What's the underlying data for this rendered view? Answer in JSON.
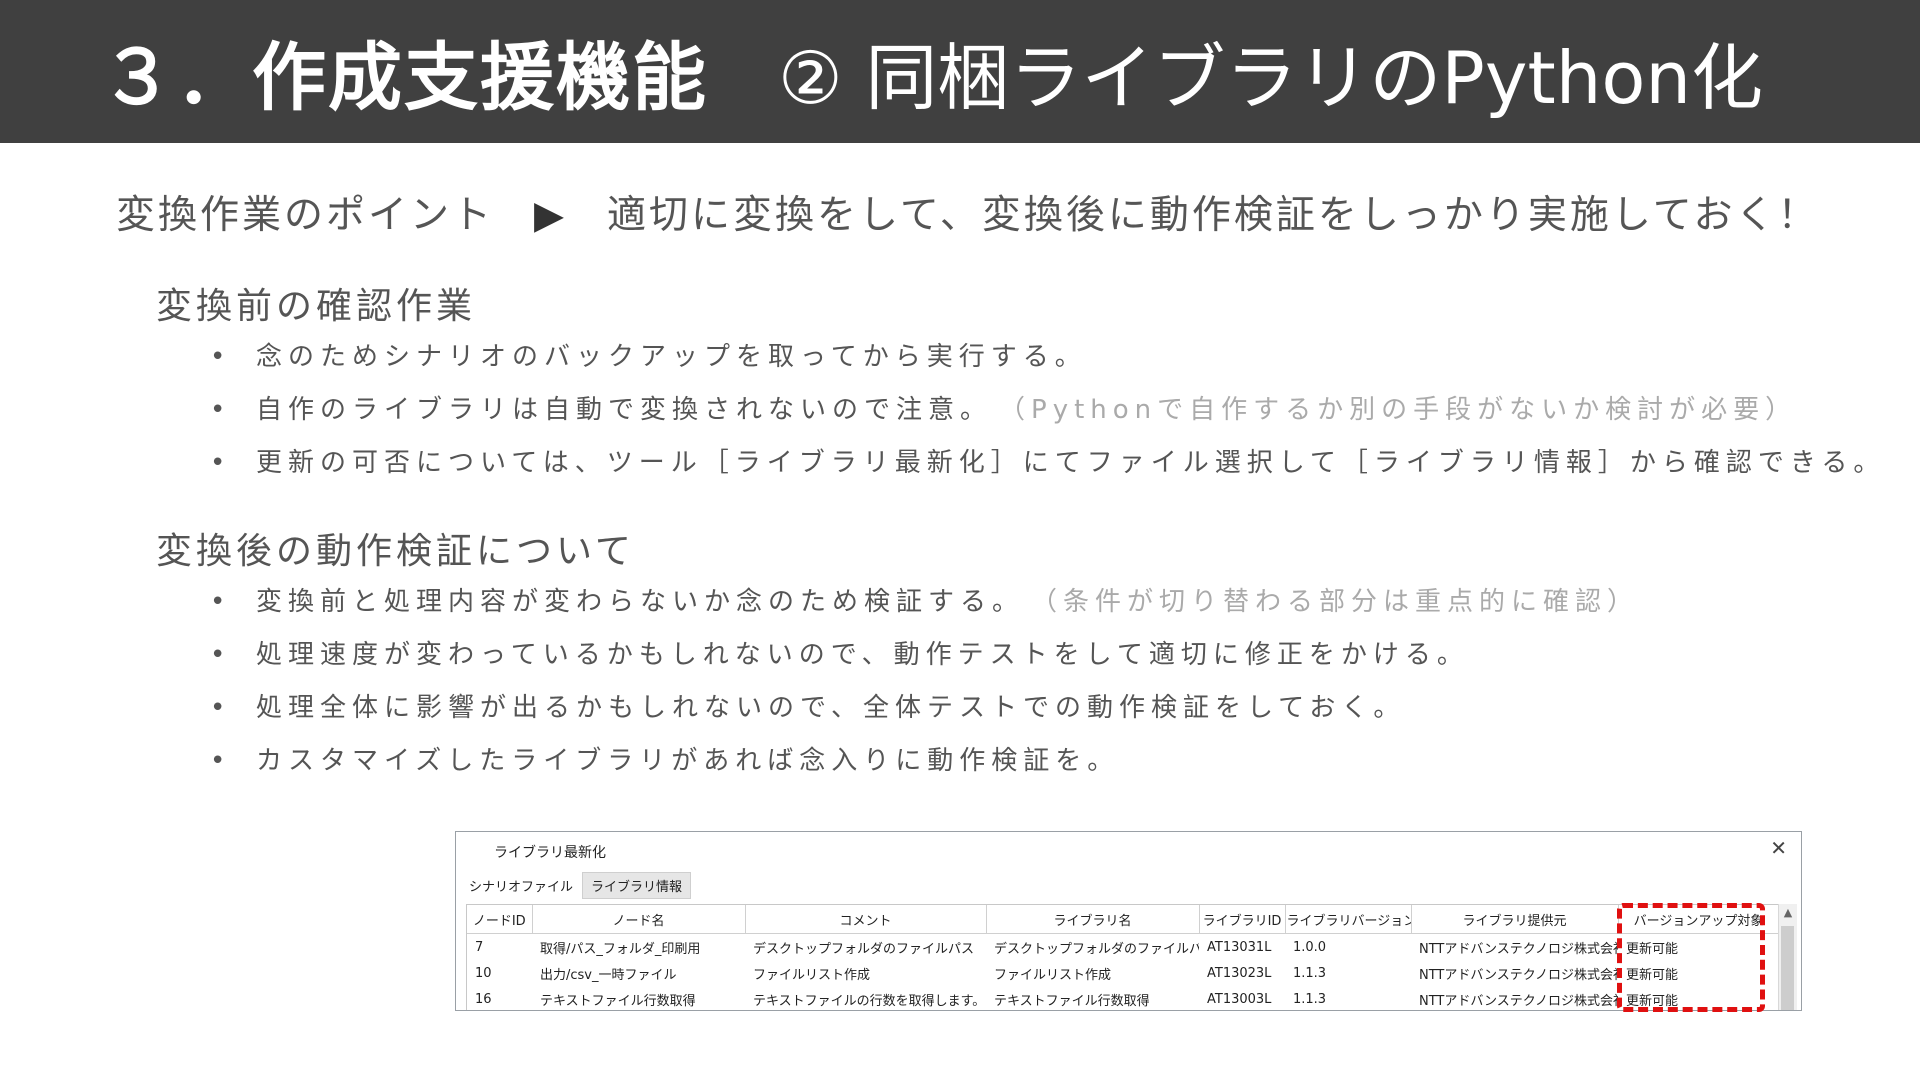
{
  "header": {
    "title_main": "３．作成支援機能",
    "title_sub": "② 同梱ライブラリのPython化"
  },
  "point": {
    "label": "変換作業のポイント",
    "arrow": "▶",
    "text": "適切に変換をして、変換後に動作検証をしっかり実施しておく！"
  },
  "section1": {
    "heading": "変換前の確認作業",
    "items": [
      {
        "text": "念のためシナリオのバックアップを取ってから実行する。",
        "note": ""
      },
      {
        "text": "自作のライブラリは自動で変換されないので注意。",
        "note": "（Pythonで自作するか別の手段がないか検討が必要）"
      },
      {
        "text": "更新の可否については、ツール［ライブラリ最新化］にてファイル選択して［ライブラリ情報］から確認できる。",
        "note": ""
      }
    ]
  },
  "section2": {
    "heading": "変換後の動作検証について",
    "items": [
      {
        "text": "変換前と処理内容が変わらないか念のため検証する。",
        "note": "（条件が切り替わる部分は重点的に確認）"
      },
      {
        "text": "処理速度が変わっているかもしれないので、動作テストをして適切に修正をかける。",
        "note": ""
      },
      {
        "text": "処理全体に影響が出るかもしれないので、全体テストでの動作検証をしておく。",
        "note": ""
      },
      {
        "text": "カスタマイズしたライブラリがあれば念入りに動作検証を。",
        "note": ""
      }
    ]
  },
  "bullet": "•",
  "dialog": {
    "title": "ライブラリ最新化",
    "close": "✕",
    "tabs": [
      "シナリオファイル",
      "ライブラリ情報"
    ],
    "columns": [
      "ノードID",
      "ノード名",
      "コメント",
      "ライブラリ名",
      "ライブラリID",
      "ライブラリバージョン",
      "ライブラリ提供元",
      "バージョンアップ対象"
    ],
    "rows": [
      [
        "7",
        "取得/パス_フォルダ_印刷用",
        "デスクトップフォルダのファイルパス",
        "デスクトップフォルダのファイルパス",
        "AT13031L",
        "1.0.0",
        "NTTアドバンステクノロジ株式会社",
        "更新可能"
      ],
      [
        "10",
        "出力/csv_一時ファイル",
        "ファイルリスト作成",
        "ファイルリスト作成",
        "AT13023L",
        "1.1.3",
        "NTTアドバンステクノロジ株式会社",
        "更新可能"
      ],
      [
        "16",
        "テキストファイル行数取得",
        "テキストファイルの行数を取得します。",
        "テキストファイル行数取得",
        "AT13003L",
        "1.1.3",
        "NTTアドバンステクノロジ株式会社",
        "更新可能"
      ]
    ],
    "scroll_up": "▲"
  },
  "colors": {
    "header_bg": "#404040",
    "highlight": "#e01010",
    "note_text": "#aaaaaa"
  }
}
